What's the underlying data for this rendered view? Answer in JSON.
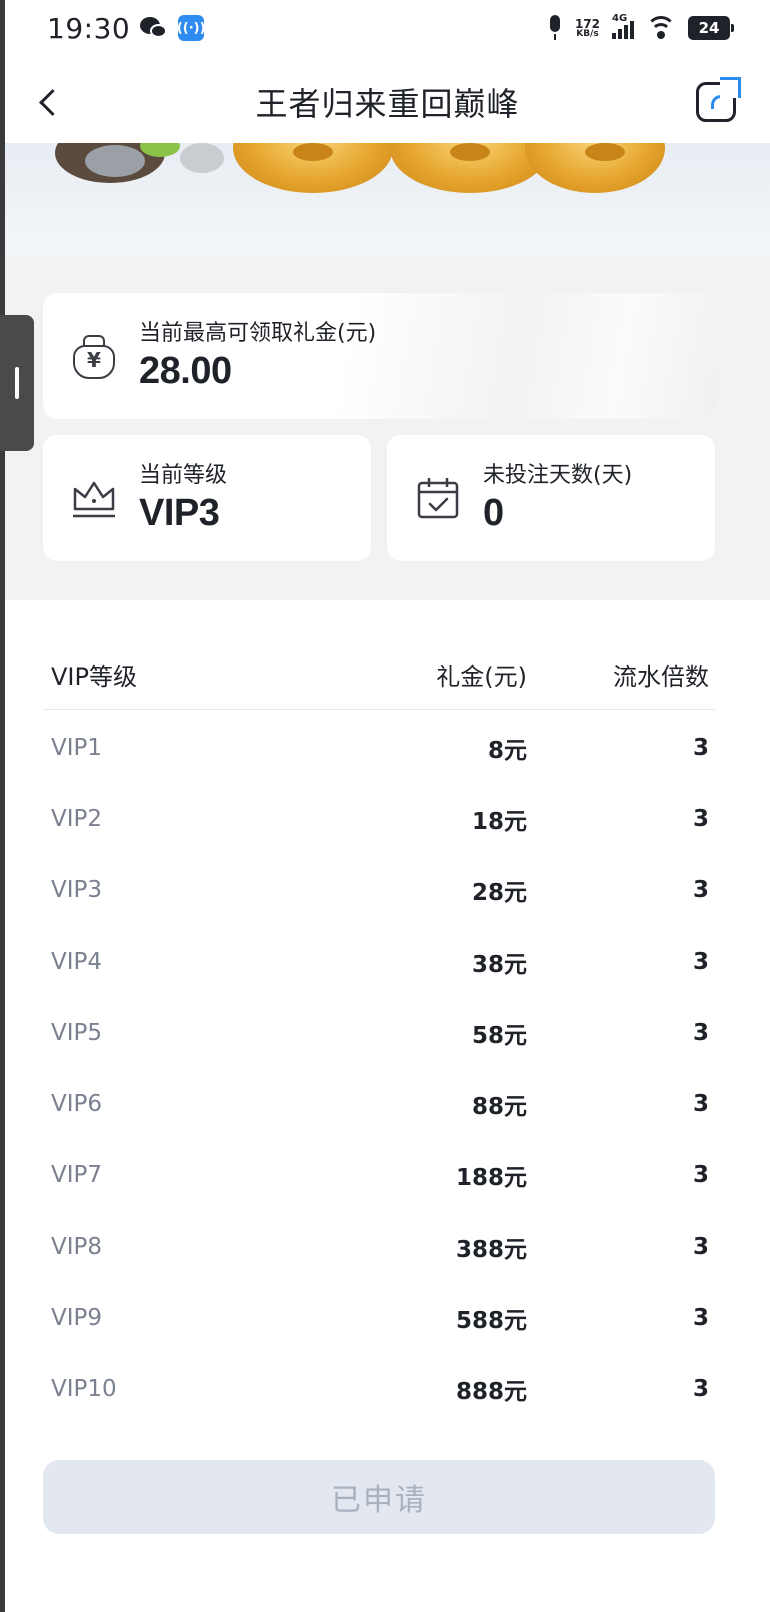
{
  "status_bar": {
    "time": "19:30",
    "network_speed_value": "172",
    "network_speed_unit": "KB/s",
    "network_type": "4G",
    "battery": "24"
  },
  "header": {
    "title": "王者归来重回巅峰"
  },
  "summary": {
    "max_gift": {
      "label": "当前最高可领取礼金(元)",
      "value": "28.00",
      "icon": "money-bag-icon"
    },
    "current_level": {
      "label": "当前等级",
      "value": "VIP3",
      "icon": "crown-icon"
    },
    "inactive_days": {
      "label": "未投注天数(天)",
      "value": "0",
      "icon": "calendar-check-icon"
    }
  },
  "table": {
    "headers": [
      "VIP等级",
      "礼金(元)",
      "流水倍数"
    ],
    "rows": [
      [
        "VIP1",
        "8元",
        "3"
      ],
      [
        "VIP2",
        "18元",
        "3"
      ],
      [
        "VIP3",
        "28元",
        "3"
      ],
      [
        "VIP4",
        "38元",
        "3"
      ],
      [
        "VIP5",
        "58元",
        "3"
      ],
      [
        "VIP6",
        "88元",
        "3"
      ],
      [
        "VIP7",
        "188元",
        "3"
      ],
      [
        "VIP8",
        "388元",
        "3"
      ],
      [
        "VIP9",
        "588元",
        "3"
      ],
      [
        "VIP10",
        "888元",
        "3"
      ]
    ]
  },
  "apply_button": {
    "label": "已申请",
    "state": "disabled"
  },
  "colors": {
    "accent": "#2e8bef",
    "text_primary": "#1f2329",
    "text_secondary": "#7b8190",
    "button_disabled_bg": "#e3e8f0",
    "button_disabled_text": "#a9b1c0"
  }
}
